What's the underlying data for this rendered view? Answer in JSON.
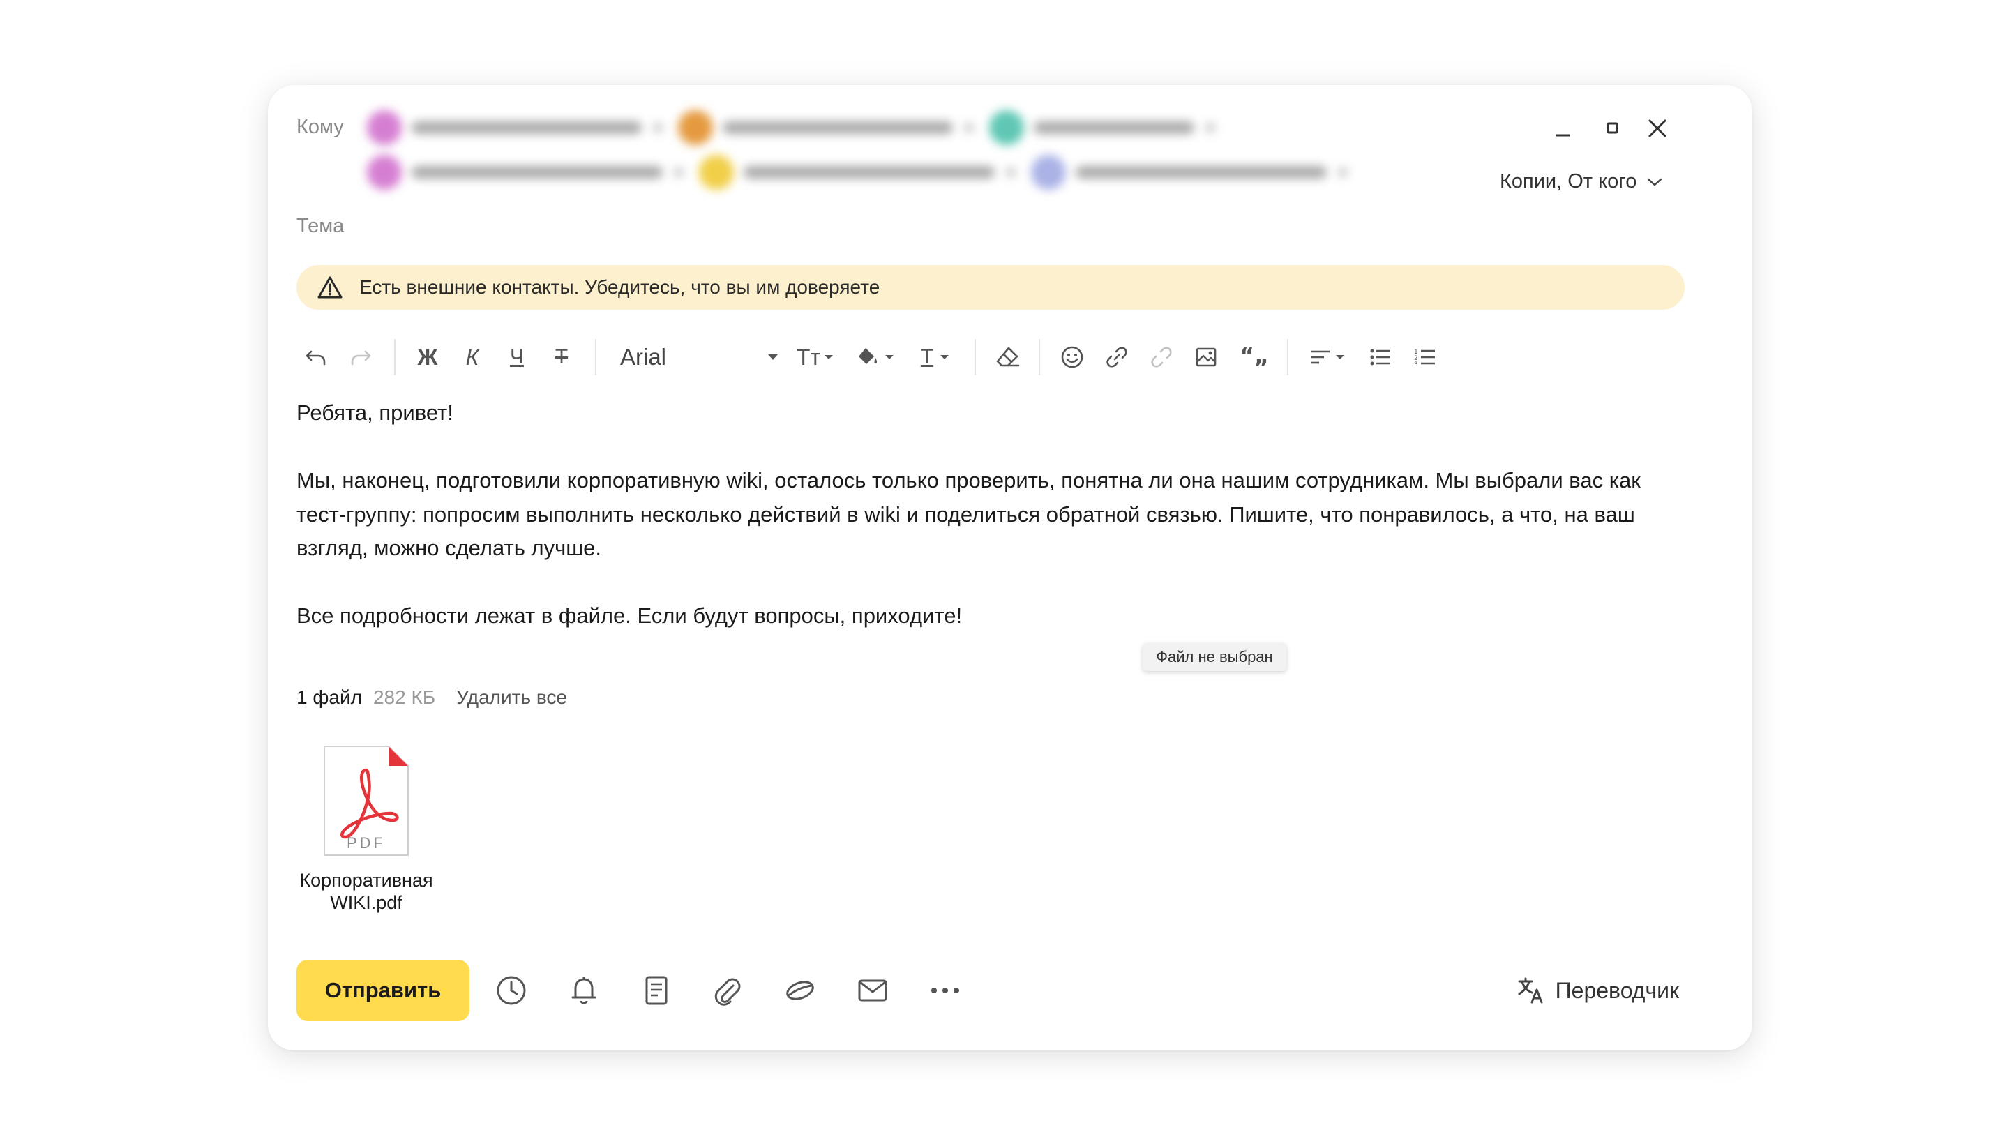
{
  "compose": {
    "to_label": "Кому",
    "subject_label": "Тема",
    "copies_label": "Копии, От кого",
    "recipients_row1": [
      {
        "color": "#d67fd2",
        "email_width": 330
      },
      {
        "color": "#e59a3f",
        "email_width": 330
      },
      {
        "color": "#5fc7b4",
        "email_width": 230
      }
    ],
    "recipients_row2": [
      {
        "color": "#d67fd2",
        "email_width": 360
      },
      {
        "color": "#f1cf48",
        "email_width": 360
      },
      {
        "color": "#aab2e6",
        "email_width": 360
      }
    ]
  },
  "warning": {
    "text": "Есть внешние контакты. Убедитесь, что вы им доверяете",
    "color": "#fdf0cf"
  },
  "toolbar": {
    "bold": "Ж",
    "italic": "К",
    "underline": "Ч",
    "strike": "Т",
    "font": "Arial",
    "size_label": "Тт",
    "text_color_label": "Т"
  },
  "body": {
    "greeting": "Ребята, привет!",
    "paragraph1": "Мы, наконец, подготовили корпоративную wiki, осталось только проверить, понятна ли она нашим сотрудникам. Мы выбрали вас как тест-группу: попросим выполнить несколько действий в wiki и поделиться обратной связью. Пишите, что понравилось, а что, на ваш взгляд, можно сделать лучше.",
    "paragraph2": "Все подробности лежат в файле. Если будут вопросы, приходите!"
  },
  "tooltip": "Файл не выбран",
  "attachments": {
    "count_label": "1 файл",
    "size": "282 КБ",
    "delete_all": "Удалить все",
    "files": [
      {
        "name": "Корпоративная WIKI.pdf",
        "type_label": "PDF"
      }
    ]
  },
  "footer": {
    "send_label": "Отправить",
    "translator_label": "Переводчик",
    "accent": "#ffdb4d"
  }
}
